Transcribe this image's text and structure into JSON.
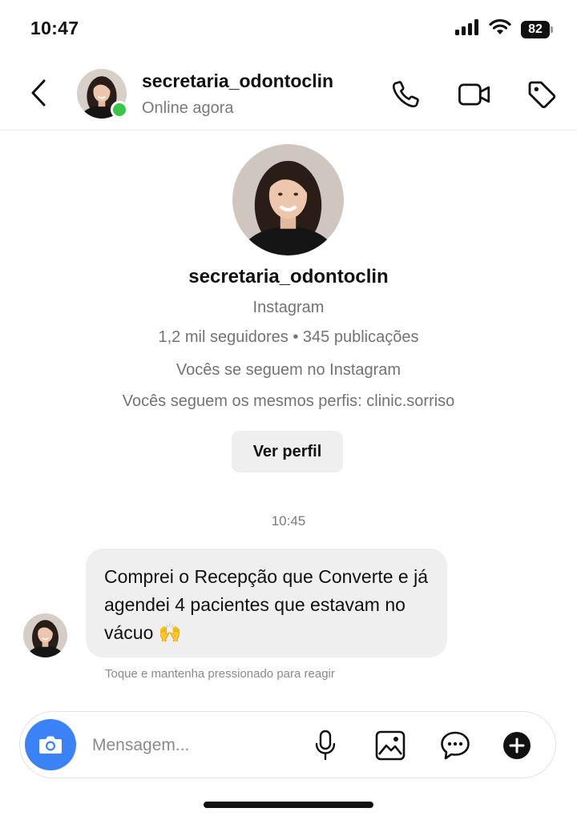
{
  "status_bar": {
    "time": "10:47",
    "battery": "82",
    "icons": [
      "signal-icon",
      "wifi-icon",
      "battery-icon"
    ]
  },
  "header": {
    "username": "secretaria_odontoclin",
    "status": "Online agora",
    "actions": [
      "phone-icon",
      "video-call-icon",
      "tag-icon"
    ],
    "online_color": "#35c64a"
  },
  "profile": {
    "username": "secretaria_odontoclin",
    "platform": "Instagram",
    "stats": "1,2 mil seguidores • 345 publicações",
    "mutual_follow": "Vocês se seguem no Instagram",
    "mutual_profiles": "Vocês seguem os mesmos perfis: clinic.sorriso",
    "view_profile_label": "Ver perfil"
  },
  "conversation": {
    "timestamp": "10:45",
    "messages": [
      {
        "sender": "secretaria_odontoclin",
        "text": "Comprei o Recepção que Converte e já agendei 4 pacientes que estavam no vácuo 🙌"
      }
    ],
    "reaction_hint": "Toque e mantenha pressionado para reagir"
  },
  "composer": {
    "placeholder": "Mensagem...",
    "accent": "#3b82f6",
    "icons": [
      "camera-icon",
      "microphone-icon",
      "gallery-icon",
      "sticker-icon",
      "plus-icon"
    ]
  }
}
